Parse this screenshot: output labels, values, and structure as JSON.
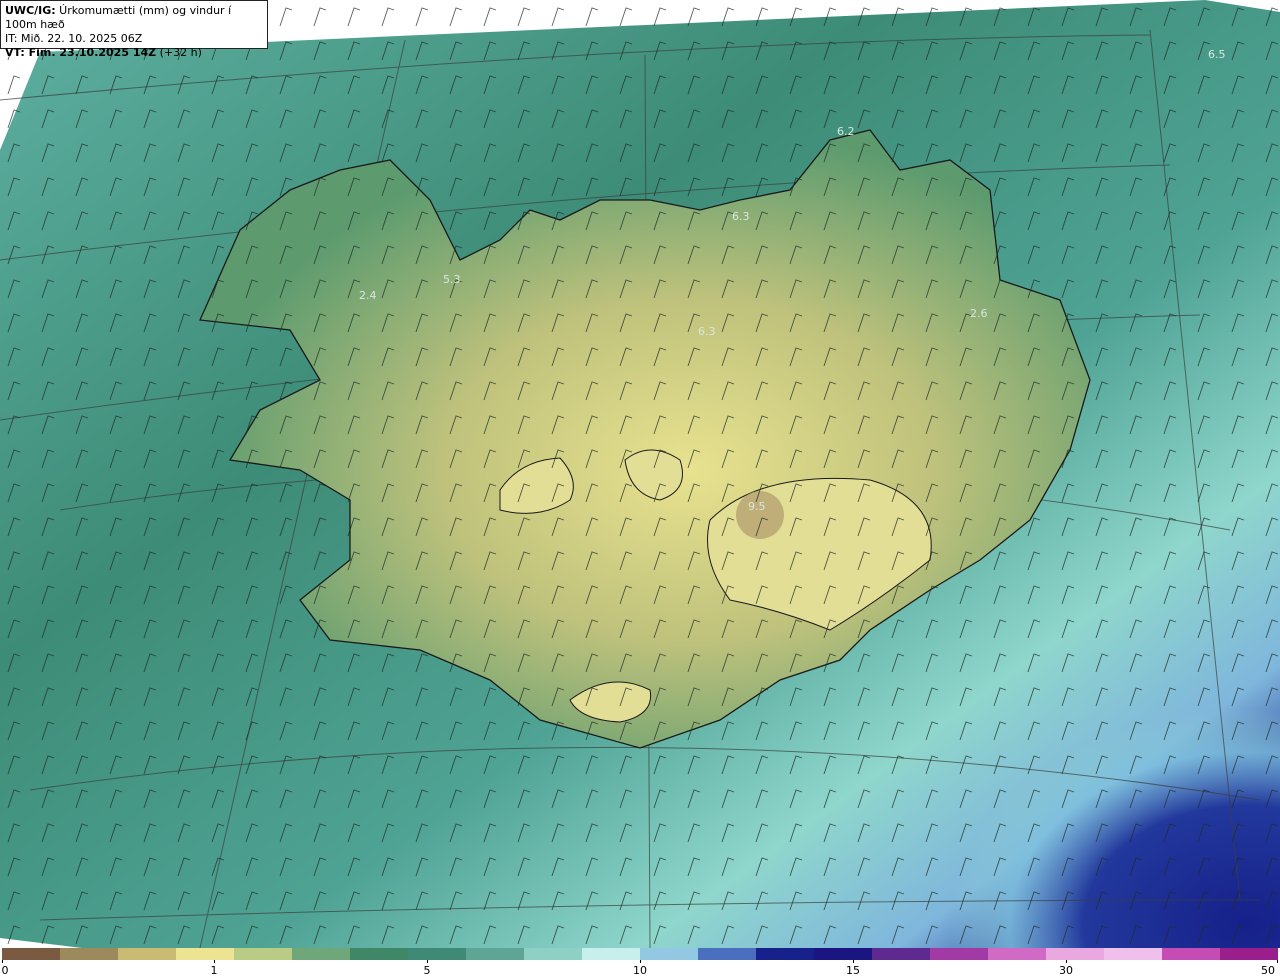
{
  "header": {
    "title_bold": "UWC/IG:",
    "title_text": " Úrkomumætti (mm) og vindur í 100m hæð",
    "init_time": "IT: Mið. 22. 10. 2025 06Z",
    "valid_bold": "VT: Fim. 23.10.2025 14Z",
    "valid_offset": " (+32 h)"
  },
  "map_labels": [
    "6.5",
    "6.2",
    "6.3",
    "5.3",
    "2.4",
    "6.3",
    "2.6",
    "9.5"
  ],
  "colorbar": {
    "ticks": [
      "0",
      "1",
      "5",
      "10",
      "15",
      "30",
      "50"
    ],
    "segments": [
      "#7a5a40",
      "#9d8a5c",
      "#c9bb74",
      "#ece492",
      "#b9cc85",
      "#6fa77a",
      "#3e8868",
      "#3f8a77",
      "#5fa595",
      "#8fd0c4",
      "#c7f0ec",
      "#93c8e2",
      "#4b6fbf",
      "#16218c",
      "#1a1580",
      "#5e2a90",
      "#a13aa5",
      "#d06ac4",
      "#e9a9e0",
      "#f0c0ec",
      "#c44cb4",
      "#9a1e8c"
    ],
    "colors": [
      "#6e5138",
      "#d6cd82",
      "#3c8a6b",
      "#bff2ec",
      "#15197f",
      "#c268c8",
      "#9d1b8e"
    ]
  }
}
